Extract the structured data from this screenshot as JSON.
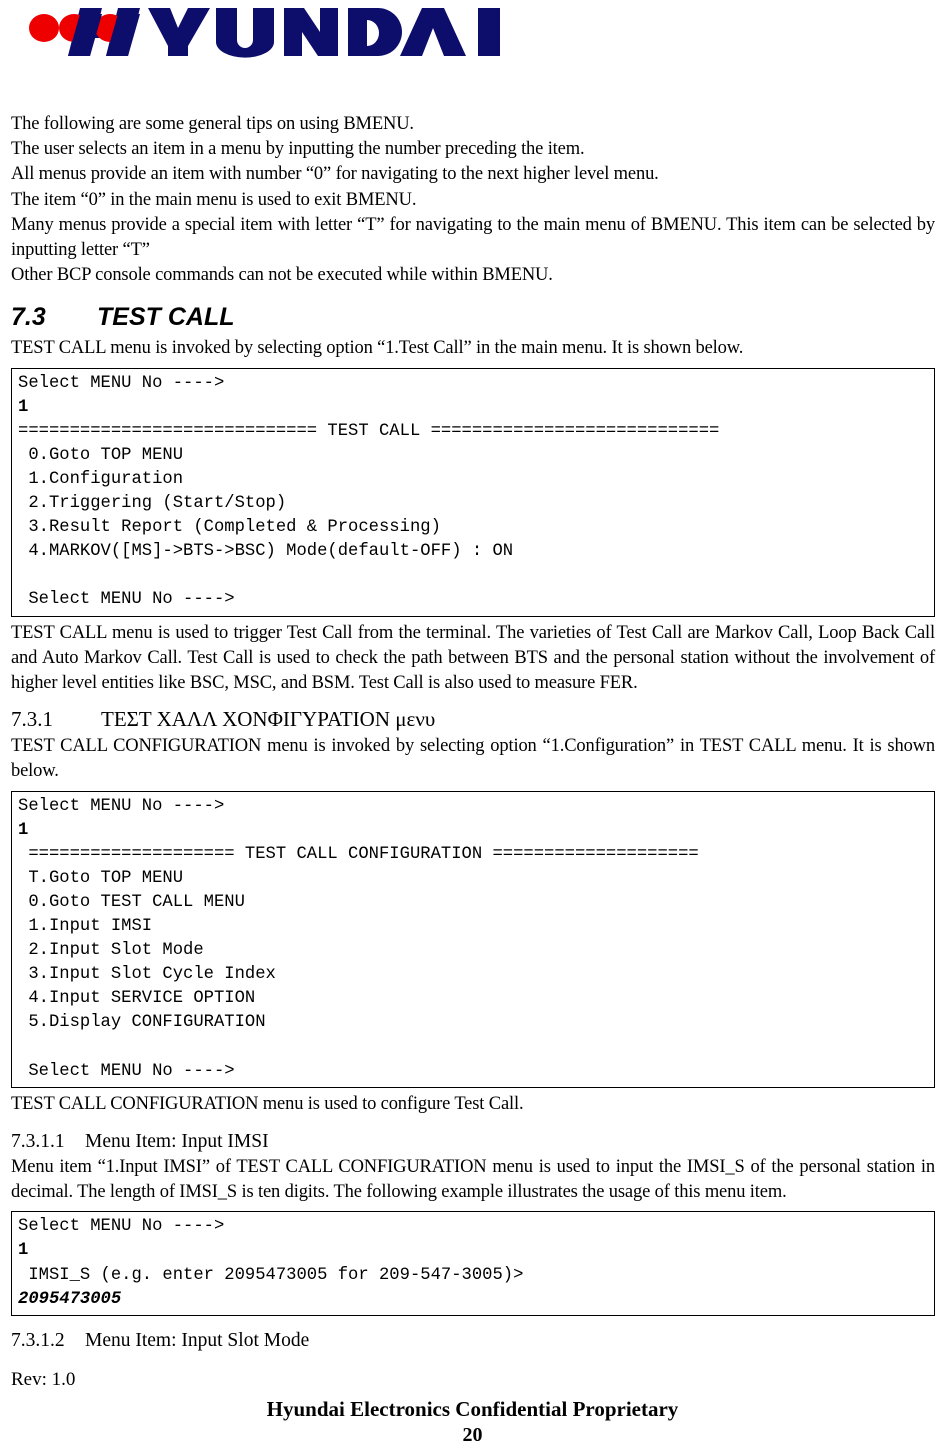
{
  "brand": {
    "name": "HYUNDAI",
    "wordmark_text": "HYUNDAI",
    "navy": "#0d0d6b",
    "red": "#ee0000"
  },
  "intro": {
    "lines": [
      "The following are some general tips on using BMENU.",
      "The user selects an item in a menu by inputting the number preceding the item.",
      "All menus provide an item with number “0” for navigating to the next higher level menu.",
      "The item “0” in the main menu is used to exit BMENU."
    ],
    "paragraph": "Many menus provide a special item with letter “T” for navigating to the main menu of BMENU. This item can be selected by inputting letter “T”",
    "last_line": "Other BCP console commands can not be executed while within BMENU."
  },
  "section_7_3": {
    "number": "7.3",
    "title": "TEST CALL",
    "intro": "TEST CALL menu is invoked by selecting option “1.Test Call” in the main menu. It is shown below.",
    "terminal": "Select MENU No ---->\n@B1@/B\n============================= TEST CALL ============================\n 0.Goto TOP MENU\n 1.Configuration\n 2.Triggering (Start/Stop)\n 3.Result Report (Completed & Processing)\n 4.MARKOV([MS]->BTS->BSC) Mode(default-OFF) : ON\n\n Select MENU No ---->",
    "description": "TEST CALL menu is used to trigger Test Call from the terminal. The varieties of Test Call are Markov Call, Loop Back Call and Auto Markov Call. Test Call is used to check the path between BTS and the personal station without the involvement of higher level entities like BSC, MSC, and BSM. Test Call is also used to measure FER."
  },
  "section_7_3_1": {
    "number": "7.3.1",
    "title": "ΤΕΣΤ ΧΑΛΛ ΧΟΝΦΙΓΥΡΑΤΙΟΝ μενυ",
    "intro": "TEST CALL CONFIGURATION menu is invoked by selecting option “1.Configuration” in TEST CALL menu. It is shown below.",
    "terminal": "Select MENU No ---->\n@B1@/B\n ==================== TEST CALL CONFIGURATION ====================\n T.Goto TOP MENU\n 0.Goto TEST CALL MENU\n 1.Input IMSI\n 2.Input Slot Mode\n 3.Input Slot Cycle Index\n 4.Input SERVICE OPTION\n 5.Display CONFIGURATION\n\n Select MENU No ---->",
    "description": "TEST CALL CONFIGURATION menu is used to configure Test Call."
  },
  "section_7_3_1_1": {
    "number": "7.3.1.1",
    "title": "Menu Item: Input IMSI",
    "description": "Menu item “1.Input IMSI” of TEST CALL CONFIGURATION menu is used to input the IMSI_S of the personal station in decimal. The length of IMSI_S is ten digits. The following example illustrates the usage of this menu item.",
    "terminal": "Select MENU No ---->\n@B1@/B\n IMSI_S (e.g. enter 2095473005 for 209-547-3005)>\n@I2095473005@/I"
  },
  "section_7_3_1_2": {
    "number": "7.3.1.2",
    "title": "Menu Item: Input Slot Mode"
  },
  "footer": {
    "rev": "Rev: 1.0",
    "confidential": "Hyundai Electronics Confidential Proprietary",
    "page_number": "20"
  }
}
